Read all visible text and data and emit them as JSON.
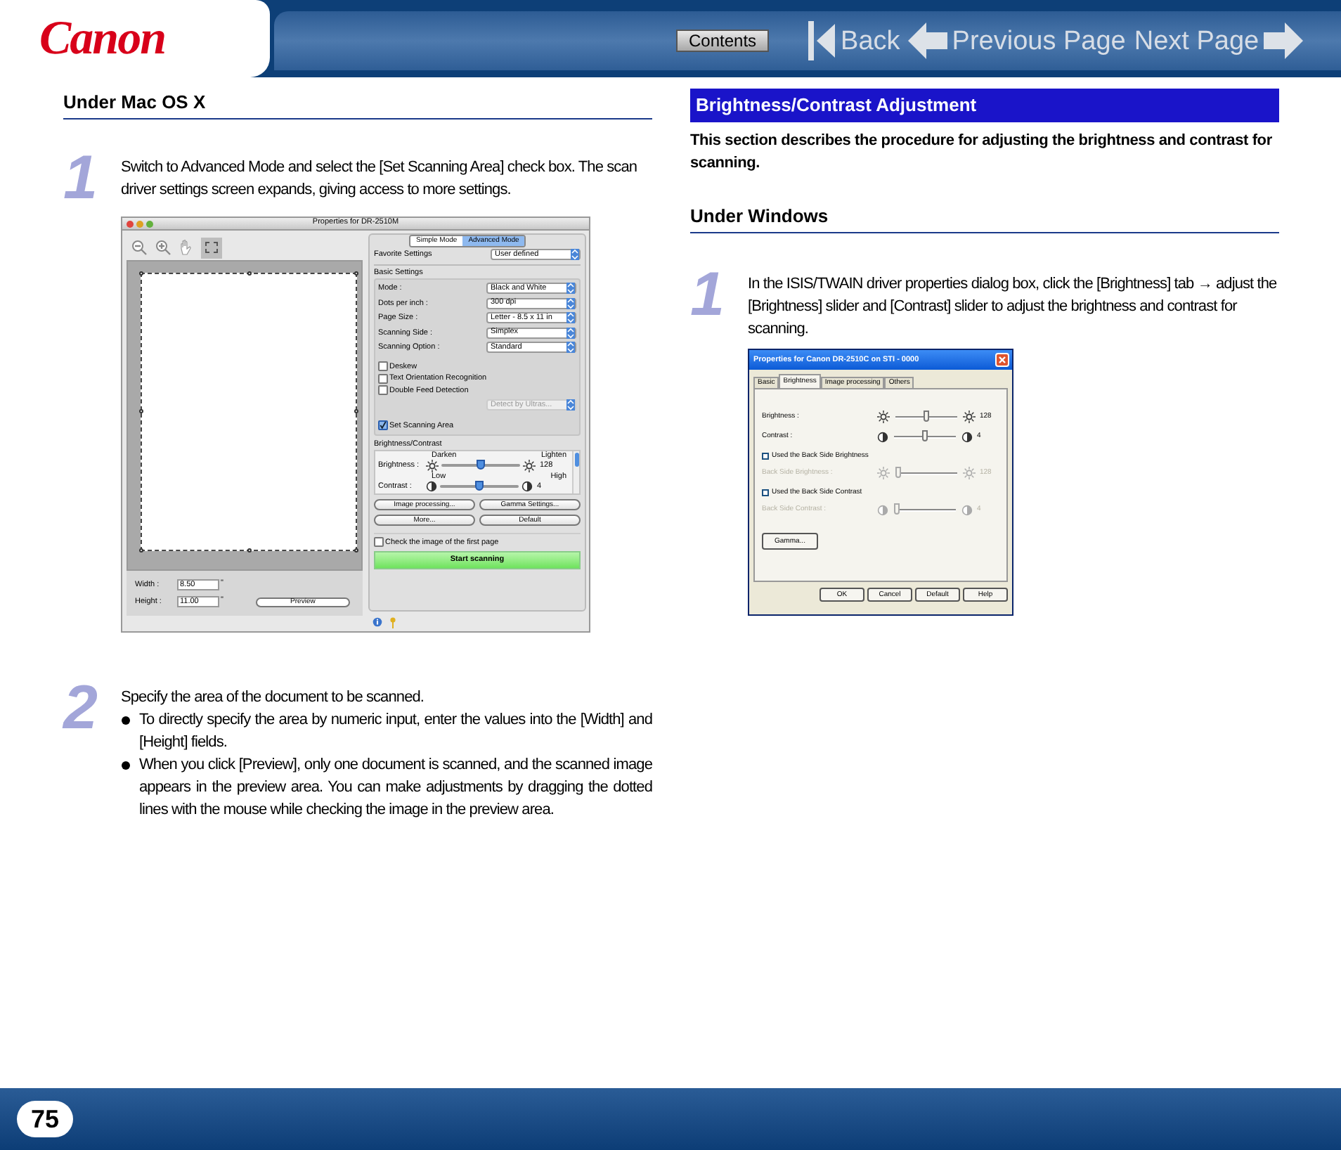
{
  "header": {
    "logo": "Canon",
    "contents_button": "Contents",
    "nav": [
      {
        "kind": "first",
        "label": "Back"
      },
      {
        "kind": "prev",
        "label": "Previous Page"
      },
      {
        "kind": "next",
        "label": "Next Page"
      }
    ]
  },
  "left": {
    "heading": "Under Mac OS X",
    "step1": {
      "number": "1",
      "text": "Switch to Advanced Mode and select the [Set Scanning Area] check box. The scan driver settings screen expands, giving access to more settings."
    },
    "mac_dialog": {
      "title": "Properties for DR-2510M",
      "modes": [
        {
          "label": "Simple Mode",
          "selected": false
        },
        {
          "label": "Advanced Mode",
          "selected": true
        }
      ],
      "favorite": {
        "label": "Favorite Settings",
        "value": "User defined"
      },
      "basic_title": "Basic Settings",
      "settings": [
        {
          "label": "Mode :",
          "value": "Black and White"
        },
        {
          "label": "Dots per inch :",
          "value": "300 dpi"
        },
        {
          "label": "Page Size :",
          "value": "Letter - 8.5 x 11 in"
        },
        {
          "label": "Scanning Side :",
          "value": "Simplex"
        },
        {
          "label": "Scanning Option :",
          "value": "Standard"
        }
      ],
      "checks": [
        {
          "label": "Deskew",
          "checked": false
        },
        {
          "label": "Text Orientation Recognition",
          "checked": false
        },
        {
          "label": "Double Feed Detection",
          "checked": false
        }
      ],
      "detect_select": {
        "value": "Detect by Ultras...",
        "disabled": true
      },
      "set_area": {
        "label": "Set Scanning Area",
        "checked": true
      },
      "bc_title": "Brightness/Contrast",
      "sliders": [
        {
          "kind": "brightness",
          "label": "Brightness :",
          "low": "Darken",
          "high": "Lighten",
          "value": "128",
          "level": 0.5
        },
        {
          "kind": "contrast",
          "label": "Contrast :",
          "low": "Low",
          "high": "High",
          "value": "4",
          "level": 0.5
        }
      ],
      "buttons": [
        "Image processing...",
        "Gamma Settings...",
        "More...",
        "Default"
      ],
      "first_page": {
        "label": "Check the image of the first page",
        "checked": false
      },
      "start_button": "Start scanning",
      "fields": [
        {
          "label": "Width :",
          "value": "8.50",
          "unit": "\""
        },
        {
          "label": "Height :",
          "value": "11.00",
          "unit": "\""
        }
      ],
      "preview_button": "Preview"
    },
    "step2": {
      "number": "2",
      "text": "Specify the area of the document to be scanned.",
      "bullets": [
        "To directly specify the area by numeric input, enter the values into the [Width] and [Height] fields.",
        "When you click [Preview], only one document is scanned, and the scanned image appears in the preview area. You can make adjustments by dragging the dotted lines with the mouse while checking the image in the preview area."
      ]
    }
  },
  "right": {
    "band": "Brightness/Contrast Adjustment",
    "intro": "This section describes the procedure for adjusting the brightness and contrast for scanning.",
    "heading": "Under Windows",
    "step1": {
      "number": "1",
      "text": "In the ISIS/TWAIN driver properties dialog box, click the [Brightness] tab → adjust the [Brightness] slider and [Contrast] slider to adjust the brightness and contrast for scanning."
    },
    "win_dialog": {
      "title": "Properties for Canon DR-2510C on STI - 0000",
      "tabs": [
        {
          "label": "Basic",
          "selected": false
        },
        {
          "label": "Brightness",
          "selected": true
        },
        {
          "label": "Image processing",
          "selected": false
        },
        {
          "label": "Others",
          "selected": false
        }
      ],
      "rows": [
        {
          "kind": "brightness",
          "label": "Brightness :",
          "value": "128",
          "level": 0.5,
          "disabled": false
        },
        {
          "kind": "contrast",
          "label": "Contrast :",
          "value": "4",
          "level": 0.5,
          "disabled": false
        },
        {
          "kind": "check",
          "label": "Used the Back Side Brightness",
          "checked": false
        },
        {
          "kind": "brightness",
          "label": "Back Side Brightness :",
          "value": "128",
          "level": 0,
          "disabled": true
        },
        {
          "kind": "check",
          "label": "Used the Back Side Contrast",
          "checked": false
        },
        {
          "kind": "contrast",
          "label": "Back Side Contrast :",
          "value": "4",
          "level": 0,
          "disabled": true
        }
      ],
      "gamma_button": "Gamma...",
      "buttons": [
        "OK",
        "Cancel",
        "Default",
        "Help"
      ]
    }
  },
  "footer": {
    "page_number": "75"
  }
}
